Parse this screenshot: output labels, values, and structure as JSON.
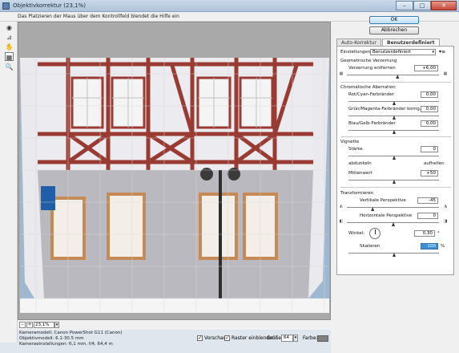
{
  "window": {
    "title": "Objektivkorrektur (23,1%)",
    "buttons": {
      "minimize": "–",
      "maximize": "□",
      "close": "✕"
    }
  },
  "hint": "Das Platzieren der Maus über dem Kontrollfeld blendet die Hilfe ein",
  "tools": [
    {
      "name": "remove-distortion-tool-icon",
      "glyph": "◉"
    },
    {
      "name": "straighten-tool-icon",
      "glyph": "⊿"
    },
    {
      "name": "hand-tool-icon",
      "glyph": "✋"
    },
    {
      "name": "grid-tool-icon",
      "glyph": "▦"
    },
    {
      "name": "zoom-tool-icon",
      "glyph": "🔍"
    }
  ],
  "zoom": {
    "minus": "–",
    "plus": "+",
    "value": "23,1%",
    "arrow": "▾"
  },
  "camera_info": {
    "line1": "Kameramodell: Canon PowerShot G11 (Canon)",
    "line2": "Objektivmodell: 6.1-30.5 mm",
    "line3": "Kameraeinstellungen: 6,1 mm, f/4, 64,4 m"
  },
  "bottom_options": {
    "preview_label": "Vorschau",
    "preview_checked": "✓",
    "grid_label": "Raster einblenden",
    "grid_checked": "✓",
    "size_label": "Größe:",
    "size_value": "64",
    "size_arrow": "▾",
    "color_label": "Farbe:",
    "grid_color": "#808080"
  },
  "dialog_buttons": {
    "ok": "OK",
    "cancel": "Abbrechen"
  },
  "tabs": [
    {
      "label": "Auto-Korrektur",
      "active": false
    },
    {
      "label": "Benutzerdefiniert",
      "active": true
    }
  ],
  "settings": {
    "label": "Einstellungen:",
    "value": "Benutzerdefiniert",
    "arrow": "▾",
    "menu_icon": "▾≡"
  },
  "geometric": {
    "section": "Geometrische Verzerrung",
    "distortion_label": "Verzerrung entfernen",
    "distortion_value": "+6,00",
    "distortion_level": 0.55
  },
  "chromatic": {
    "section": "Chromatische Aberration",
    "red_cyan_label": "Rot/Cyan-Farbränder",
    "red_cyan_value": "0,00",
    "green_magenta_label": "Grün/Magenta-Farbränder korrig.",
    "green_magenta_value": "0,00",
    "blue_yellow_label": "Blau/Gelb-Farbränder",
    "blue_yellow_value": "0,00"
  },
  "vignette": {
    "section": "Vignette",
    "strength_label": "Stärke",
    "strength_value": "0",
    "darken_label": "abdunkeln",
    "brighten_label": "aufhellen",
    "midpoint_label": "Mittenwert",
    "midpoint_value": "+50"
  },
  "transform": {
    "section": "Transformieren",
    "vertical_label": "Vertikale Perspektive",
    "vertical_value": "-45",
    "vertical_level": 0.28,
    "horizontal_label": "Horizontale Perspektive",
    "horizontal_value": "0",
    "angle_label": "Winkel:",
    "angle_value": "0,30",
    "angle_unit": "°",
    "scale_label": "Skalieren",
    "scale_value": "100",
    "scale_unit": "%"
  }
}
